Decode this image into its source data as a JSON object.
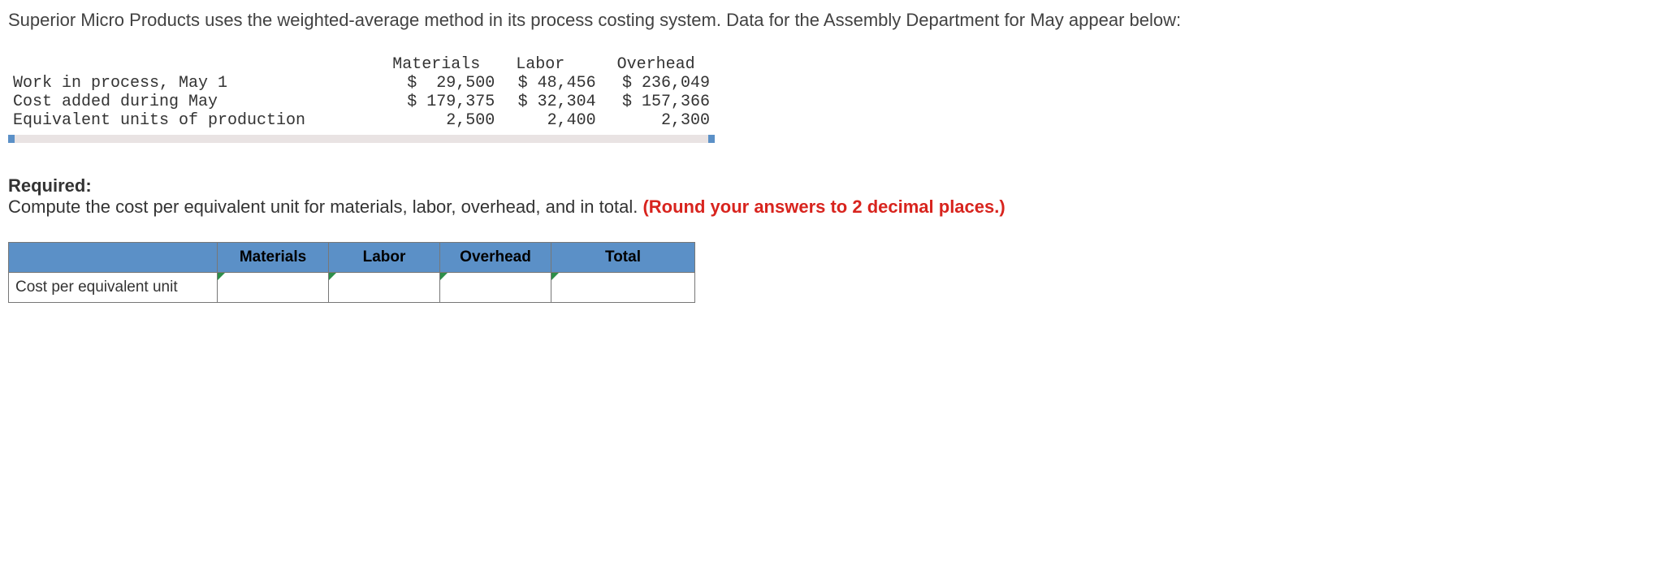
{
  "intro": "Superior Micro Products uses the weighted-average method in its process costing system. Data for the Assembly Department for May appear below:",
  "data_table": {
    "cols": [
      "Materials",
      "Labor",
      "Overhead"
    ],
    "rows": [
      {
        "label": "Work in process, May 1",
        "cells": [
          "$  29,500",
          "$ 48,456",
          "$ 236,049"
        ]
      },
      {
        "label": "Cost added during May",
        "cells": [
          "$ 179,375",
          "$ 32,304",
          "$ 157,366"
        ]
      },
      {
        "label": "Equivalent units of production",
        "cells": [
          "   2,500",
          "  2,400",
          "   2,300"
        ]
      }
    ]
  },
  "required_label": "Required:",
  "required_text": "Compute the cost per equivalent unit for materials, labor, overhead, and in total. ",
  "hint": "(Round your answers to 2 decimal places.)",
  "answer": {
    "cols": [
      "Materials",
      "Labor",
      "Overhead",
      "Total"
    ],
    "row_label": "Cost per equivalent unit"
  },
  "chart_data": {
    "type": "table",
    "title": "Assembly Department cost data for May (weighted-average)",
    "columns": [
      "Materials",
      "Labor",
      "Overhead"
    ],
    "rows": {
      "Work in process, May 1": [
        29500,
        48456,
        236049
      ],
      "Cost added during May": [
        179375,
        32304,
        157366
      ],
      "Equivalent units of production": [
        2500,
        2400,
        2300
      ]
    }
  }
}
